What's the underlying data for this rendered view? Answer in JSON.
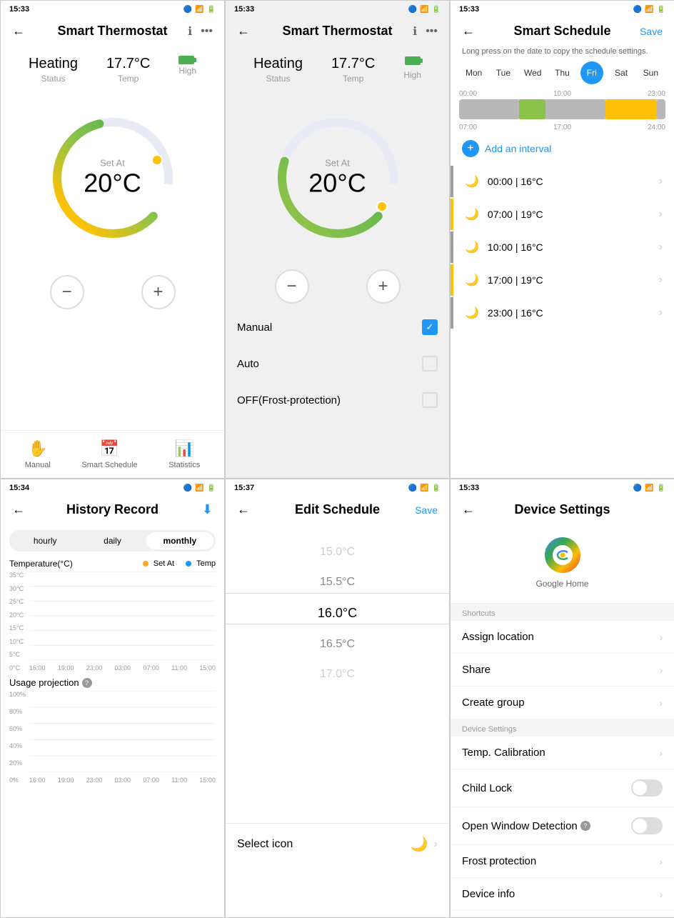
{
  "screens": {
    "s1": {
      "time": "15:33",
      "title": "Smart Thermostat",
      "status_label": "Status",
      "status_value": "Heating",
      "temp_label": "Temp",
      "temp_value": "17.7°C",
      "battery_label": "High",
      "set_at_label": "Set At",
      "set_at_value": "20°C",
      "minus_btn": "−",
      "plus_btn": "+",
      "nav": {
        "manual_label": "Manual",
        "schedule_label": "Smart Schedule",
        "stats_label": "Statistics"
      }
    },
    "s2": {
      "time": "15:33",
      "title": "Smart Thermostat",
      "status_value": "Heating",
      "status_label": "Status",
      "temp_value": "17.7°C",
      "temp_label": "Temp",
      "battery_label": "High",
      "set_at_label": "Set At",
      "set_at_value": "20°C",
      "modes": [
        {
          "label": "Manual",
          "checked": true
        },
        {
          "label": "Auto",
          "checked": false
        },
        {
          "label": "OFF(Frost-protection)",
          "checked": false
        }
      ]
    },
    "s3": {
      "time": "15:33",
      "title": "Smart Schedule",
      "save_label": "Save",
      "subtitle": "Long press on the date to copy the schedule settings.",
      "days": [
        "Mon",
        "Tue",
        "Wed",
        "Thu",
        "Fri",
        "Sat",
        "Sun"
      ],
      "active_day": "Fri",
      "time_scale_start": "00:00",
      "time_scale_mid": "10:00",
      "time_scale_end": "23:00",
      "time_labels": [
        "07:00",
        "17:00",
        "24:00"
      ],
      "add_interval_label": "Add an interval",
      "intervals": [
        {
          "time": "00:00 | 16°C",
          "color": "#9E9E9E"
        },
        {
          "time": "07:00 | 19°C",
          "color": "#FFC107"
        },
        {
          "time": "10:00 | 16°C",
          "color": "#9E9E9E"
        },
        {
          "time": "17:00 | 19°C",
          "color": "#FFC107"
        },
        {
          "time": "23:00 | 16°C",
          "color": "#9E9E9E"
        }
      ]
    },
    "s4": {
      "time": "15:34",
      "title": "History Record",
      "download_label": "⬇",
      "tabs": [
        "hourly",
        "daily",
        "monthly"
      ],
      "active_tab": "monthly",
      "chart_title": "Temperature(°C)",
      "legend": [
        {
          "label": "Set At",
          "color": "#FFA726"
        },
        {
          "label": "Temp",
          "color": "#2196F3"
        }
      ],
      "y_labels": [
        "35°C",
        "30°C",
        "25°C",
        "20°C",
        "15°C",
        "10°C",
        "5°C",
        "0°C"
      ],
      "x_labels": [
        "16:00",
        "19:00",
        "23:00",
        "03:00",
        "07:00",
        "11:00",
        "15:00"
      ],
      "usage_title": "Usage projection",
      "usage_y_labels": [
        "100%",
        "80%",
        "60%",
        "40%",
        "20%",
        "0%"
      ],
      "usage_x_labels": [
        "16:00",
        "19:00",
        "23:00",
        "03:00",
        "07:00",
        "11:00",
        "15:00"
      ]
    },
    "s5": {
      "time": "15:37",
      "title": "Edit Schedule",
      "save_label": "Save",
      "temps": [
        "15.0°C",
        "15.5°C",
        "16.0°C",
        "16.5°C",
        "17.0°C"
      ],
      "selected_temp": "16.0°C",
      "select_icon_label": "Select icon"
    },
    "s6": {
      "time": "15:33",
      "title": "Device Settings",
      "google_home_label": "Google Home",
      "shortcuts_header": "Shortcuts",
      "assign_location_label": "Assign location",
      "share_label": "Share",
      "create_group_label": "Create group",
      "device_settings_header": "Device Settings",
      "temp_calibration_label": "Temp. Calibration",
      "child_lock_label": "Child Lock",
      "window_detection_label": "Open Window Detection",
      "frost_protection_label": "Frost protection",
      "device_info_label": "Device info"
    }
  }
}
